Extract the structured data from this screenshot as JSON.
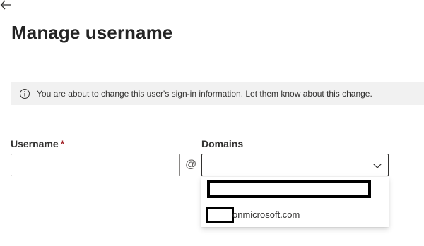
{
  "header": {
    "back_icon": "back-arrow-icon",
    "title": "Manage username"
  },
  "info_bar": {
    "icon": "info-icon",
    "message": "You are about to change this user's sign-in information. Let them know about this change."
  },
  "form": {
    "username": {
      "label": "Username",
      "required_marker": "*",
      "value": "",
      "placeholder": ""
    },
    "separator": "@",
    "domains": {
      "label": "Domains",
      "selected_value": "",
      "chevron_icon": "chevron-down-icon",
      "options": [
        {
          "label": "",
          "redacted": true
        },
        {
          "label": "onmicrosoft.com",
          "prefix_redacted": true
        }
      ]
    }
  },
  "colors": {
    "info_bar_bg": "#f1f1f1",
    "required": "#a4262c",
    "text": "#242424",
    "input_border": "#8a8886"
  }
}
